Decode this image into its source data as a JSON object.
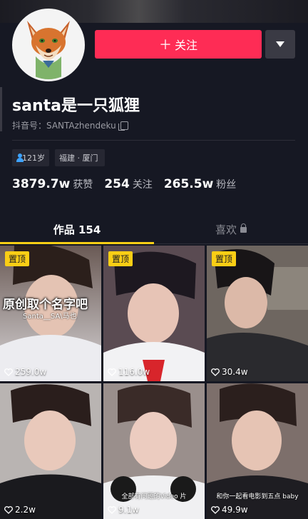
{
  "profile": {
    "avatar_icon": "fox-avatar-icon",
    "nickname": "santa是一只狐狸",
    "douyin_id": "抖音号：SANTAzhendeku",
    "age_tag": "121岁",
    "location_tag": "福建 · 厦门"
  },
  "actions": {
    "follow_label": "关注",
    "follow_color": "#fe2c55",
    "more_icon": "chevron-down-icon"
  },
  "stats": [
    {
      "value": "3879.7w",
      "label": "获赞"
    },
    {
      "value": "254",
      "label": "关注"
    },
    {
      "value": "265.5w",
      "label": "粉丝"
    }
  ],
  "tabs": {
    "works_label": "作品 154",
    "likes_label": "喜欢",
    "indicator_color": "#face15"
  },
  "videos": [
    {
      "pinned": "置顶",
      "likes": "259.0w",
      "title": "原创取个名字吧",
      "subtitle": "Santa__SA\\马也"
    },
    {
      "pinned": "置顶",
      "likes": "116.0w"
    },
    {
      "pinned": "置顶",
      "likes": "30.4w"
    },
    {
      "likes": "2.2w"
    },
    {
      "likes": "9.1w",
      "caption": "全部有问题的Video 片"
    },
    {
      "likes": "49.9w",
      "caption": "和你一起看电影到五点 baby"
    }
  ]
}
